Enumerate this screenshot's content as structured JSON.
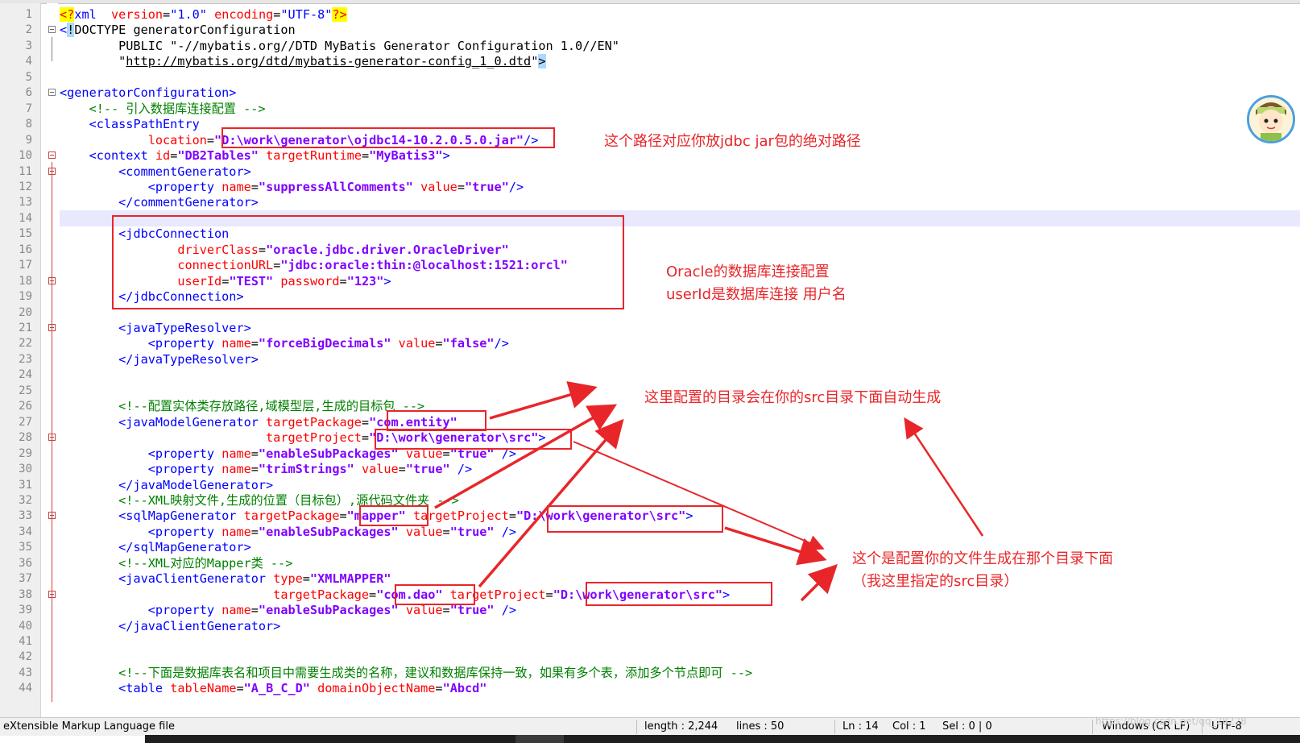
{
  "editor": {
    "lines": [
      {
        "n": "1",
        "t": [
          [
            "pi",
            "<?"
          ],
          [
            "tag",
            "xml"
          ],
          [
            "",
            "  "
          ],
          [
            "attr",
            "version"
          ],
          [
            "",
            "="
          ],
          [
            "tag",
            "\"1.0\""
          ],
          [
            "",
            " "
          ],
          [
            "attr",
            "encoding"
          ],
          [
            "",
            "="
          ],
          [
            "tag",
            "\"UTF-8\""
          ],
          [
            "pi",
            "?>"
          ]
        ]
      },
      {
        "n": "2",
        "t": [
          [
            "tag",
            "<"
          ],
          [
            "hl",
            "!"
          ],
          [
            "",
            "DOCTYPE generatorConfiguration"
          ]
        ]
      },
      {
        "n": "3",
        "t": [
          [
            "",
            "        PUBLIC \"-//mybatis.org//DTD MyBatis Generator Configuration 1.0//EN\""
          ]
        ]
      },
      {
        "n": "4",
        "t": [
          [
            "",
            "        \""
          ],
          [
            "url",
            "http://mybatis.org/dtd/mybatis-generator-config_1_0.dtd"
          ],
          [
            "",
            "\""
          ],
          [
            "hl",
            ">"
          ]
        ]
      },
      {
        "n": "5",
        "t": []
      },
      {
        "n": "6",
        "t": [
          [
            "tag",
            "<generatorConfiguration>"
          ]
        ]
      },
      {
        "n": "7",
        "t": [
          [
            "",
            "    "
          ],
          [
            "cm",
            "<!-- 引入数据库连接配置 -->"
          ]
        ]
      },
      {
        "n": "8",
        "t": [
          [
            "",
            "    "
          ],
          [
            "tag",
            "<classPathEntry"
          ]
        ]
      },
      {
        "n": "9",
        "t": [
          [
            "",
            "            "
          ],
          [
            "attr",
            "location"
          ],
          [
            "",
            "="
          ],
          [
            "val",
            "\"D:\\work\\generator\\ojdbc14-10.2.0.5.0.jar\""
          ],
          [
            "tag",
            "/>"
          ]
        ]
      },
      {
        "n": "10",
        "t": [
          [
            "",
            "    "
          ],
          [
            "tag",
            "<context"
          ],
          [
            "",
            " "
          ],
          [
            "attr",
            "id"
          ],
          [
            "",
            "="
          ],
          [
            "val",
            "\"DB2Tables\""
          ],
          [
            "",
            " "
          ],
          [
            "attr",
            "targetRuntime"
          ],
          [
            "",
            "="
          ],
          [
            "val",
            "\"MyBatis3\""
          ],
          [
            "tag",
            ">"
          ]
        ]
      },
      {
        "n": "11",
        "t": [
          [
            "",
            "        "
          ],
          [
            "tag",
            "<commentGenerator>"
          ]
        ]
      },
      {
        "n": "12",
        "t": [
          [
            "",
            "            "
          ],
          [
            "tag",
            "<property"
          ],
          [
            "",
            " "
          ],
          [
            "attr",
            "name"
          ],
          [
            "",
            "="
          ],
          [
            "val",
            "\"suppressAllComments\""
          ],
          [
            "",
            " "
          ],
          [
            "attr",
            "value"
          ],
          [
            "",
            "="
          ],
          [
            "val",
            "\"true\""
          ],
          [
            "tag",
            "/>"
          ]
        ]
      },
      {
        "n": "13",
        "t": [
          [
            "",
            "        "
          ],
          [
            "tag",
            "</commentGenerator>"
          ]
        ]
      },
      {
        "n": "14",
        "t": []
      },
      {
        "n": "15",
        "t": [
          [
            "",
            "        "
          ],
          [
            "tag",
            "<jdbcConnection"
          ]
        ]
      },
      {
        "n": "16",
        "t": [
          [
            "",
            "                "
          ],
          [
            "attr",
            "driverClass"
          ],
          [
            "",
            "="
          ],
          [
            "val",
            "\"oracle.jdbc.driver.OracleDriver\""
          ]
        ]
      },
      {
        "n": "17",
        "t": [
          [
            "",
            "                "
          ],
          [
            "attr",
            "connectionURL"
          ],
          [
            "",
            "="
          ],
          [
            "val",
            "\"jdbc:oracle:thin:@localhost:1521:orcl\""
          ]
        ]
      },
      {
        "n": "18",
        "t": [
          [
            "",
            "                "
          ],
          [
            "attr",
            "userId"
          ],
          [
            "",
            "="
          ],
          [
            "val",
            "\"TEST\""
          ],
          [
            "",
            " "
          ],
          [
            "attr",
            "password"
          ],
          [
            "",
            "="
          ],
          [
            "val",
            "\"123\""
          ],
          [
            "tag",
            ">"
          ]
        ]
      },
      {
        "n": "19",
        "t": [
          [
            "",
            "        "
          ],
          [
            "tag",
            "</jdbcConnection>"
          ]
        ]
      },
      {
        "n": "20",
        "t": []
      },
      {
        "n": "21",
        "t": [
          [
            "",
            "        "
          ],
          [
            "tag",
            "<javaTypeResolver>"
          ]
        ]
      },
      {
        "n": "22",
        "t": [
          [
            "",
            "            "
          ],
          [
            "tag",
            "<property"
          ],
          [
            "",
            " "
          ],
          [
            "attr",
            "name"
          ],
          [
            "",
            "="
          ],
          [
            "val",
            "\"forceBigDecimals\""
          ],
          [
            "",
            " "
          ],
          [
            "attr",
            "value"
          ],
          [
            "",
            "="
          ],
          [
            "val",
            "\"false\""
          ],
          [
            "tag",
            "/>"
          ]
        ]
      },
      {
        "n": "23",
        "t": [
          [
            "",
            "        "
          ],
          [
            "tag",
            "</javaTypeResolver>"
          ]
        ]
      },
      {
        "n": "24",
        "t": []
      },
      {
        "n": "25",
        "t": []
      },
      {
        "n": "26",
        "t": [
          [
            "",
            "        "
          ],
          [
            "cm",
            "<!--配置实体类存放路径,域模型层,生成的目标包 -->"
          ]
        ]
      },
      {
        "n": "27",
        "t": [
          [
            "",
            "        "
          ],
          [
            "tag",
            "<javaModelGenerator"
          ],
          [
            "",
            " "
          ],
          [
            "attr",
            "targetPackage"
          ],
          [
            "",
            "="
          ],
          [
            "val",
            "\"com.entity\""
          ]
        ]
      },
      {
        "n": "28",
        "t": [
          [
            "",
            "                            "
          ],
          [
            "attr",
            "targetProject"
          ],
          [
            "",
            "="
          ],
          [
            "val",
            "\"D:\\work\\generator\\src\""
          ],
          [
            "tag",
            ">"
          ]
        ]
      },
      {
        "n": "29",
        "t": [
          [
            "",
            "            "
          ],
          [
            "tag",
            "<property"
          ],
          [
            "",
            " "
          ],
          [
            "attr",
            "name"
          ],
          [
            "",
            "="
          ],
          [
            "val",
            "\"enableSubPackages\""
          ],
          [
            "",
            " "
          ],
          [
            "attr",
            "value"
          ],
          [
            "",
            "="
          ],
          [
            "val",
            "\"true\""
          ],
          [
            "",
            " "
          ],
          [
            "tag",
            "/>"
          ]
        ]
      },
      {
        "n": "30",
        "t": [
          [
            "",
            "            "
          ],
          [
            "tag",
            "<property"
          ],
          [
            "",
            " "
          ],
          [
            "attr",
            "name"
          ],
          [
            "",
            "="
          ],
          [
            "val",
            "\"trimStrings\""
          ],
          [
            "",
            " "
          ],
          [
            "attr",
            "value"
          ],
          [
            "",
            "="
          ],
          [
            "val",
            "\"true\""
          ],
          [
            "",
            " "
          ],
          [
            "tag",
            "/>"
          ]
        ]
      },
      {
        "n": "31",
        "t": [
          [
            "",
            "        "
          ],
          [
            "tag",
            "</javaModelGenerator>"
          ]
        ]
      },
      {
        "n": "32",
        "t": [
          [
            "",
            "        "
          ],
          [
            "cm",
            "<!--XML映射文件,生成的位置（目标包）,源代码文件夹 -->"
          ]
        ]
      },
      {
        "n": "33",
        "t": [
          [
            "",
            "        "
          ],
          [
            "tag",
            "<sqlMapGenerator"
          ],
          [
            "",
            " "
          ],
          [
            "attr",
            "targetPackage"
          ],
          [
            "",
            "="
          ],
          [
            "val",
            "\"mapper\""
          ],
          [
            "",
            " "
          ],
          [
            "attr",
            "targetProject"
          ],
          [
            "",
            "="
          ],
          [
            "val",
            "\"D:\\work\\generator\\src\""
          ],
          [
            "tag",
            ">"
          ]
        ]
      },
      {
        "n": "34",
        "t": [
          [
            "",
            "            "
          ],
          [
            "tag",
            "<property"
          ],
          [
            "",
            " "
          ],
          [
            "attr",
            "name"
          ],
          [
            "",
            "="
          ],
          [
            "val",
            "\"enableSubPackages\""
          ],
          [
            "",
            " "
          ],
          [
            "attr",
            "value"
          ],
          [
            "",
            "="
          ],
          [
            "val",
            "\"true\""
          ],
          [
            "",
            " "
          ],
          [
            "tag",
            "/>"
          ]
        ]
      },
      {
        "n": "35",
        "t": [
          [
            "",
            "        "
          ],
          [
            "tag",
            "</sqlMapGenerator>"
          ]
        ]
      },
      {
        "n": "36",
        "t": [
          [
            "",
            "        "
          ],
          [
            "cm",
            "<!--XML对应的Mapper类 -->"
          ]
        ]
      },
      {
        "n": "37",
        "t": [
          [
            "",
            "        "
          ],
          [
            "tag",
            "<javaClientGenerator"
          ],
          [
            "",
            " "
          ],
          [
            "attr",
            "type"
          ],
          [
            "",
            "="
          ],
          [
            "val",
            "\"XMLMAPPER\""
          ]
        ]
      },
      {
        "n": "38",
        "t": [
          [
            "",
            "                             "
          ],
          [
            "attr",
            "targetPackage"
          ],
          [
            "",
            "="
          ],
          [
            "val",
            "\"com.dao\""
          ],
          [
            "",
            " "
          ],
          [
            "attr",
            "targetProject"
          ],
          [
            "",
            "="
          ],
          [
            "val",
            "\"D:\\work\\generator\\src\""
          ],
          [
            "tag",
            ">"
          ]
        ]
      },
      {
        "n": "39",
        "t": [
          [
            "",
            "            "
          ],
          [
            "tag",
            "<property"
          ],
          [
            "",
            " "
          ],
          [
            "attr",
            "name"
          ],
          [
            "",
            "="
          ],
          [
            "val",
            "\"enableSubPackages\""
          ],
          [
            "",
            " "
          ],
          [
            "attr",
            "value"
          ],
          [
            "",
            "="
          ],
          [
            "val",
            "\"true\""
          ],
          [
            "",
            " "
          ],
          [
            "tag",
            "/>"
          ]
        ]
      },
      {
        "n": "40",
        "t": [
          [
            "",
            "        "
          ],
          [
            "tag",
            "</javaClientGenerator>"
          ]
        ]
      },
      {
        "n": "41",
        "t": []
      },
      {
        "n": "42",
        "t": []
      },
      {
        "n": "43",
        "t": [
          [
            "",
            "        "
          ],
          [
            "cm",
            "<!--下面是数据库表名和项目中需要生成类的名称，建议和数据库保持一致，如果有多个表，添加多个节点即可 -->"
          ]
        ]
      },
      {
        "n": "44",
        "t": [
          [
            "",
            "        "
          ],
          [
            "tag",
            "<table"
          ],
          [
            "",
            " "
          ],
          [
            "attr",
            "tableName"
          ],
          [
            "",
            "="
          ],
          [
            "val",
            "\"A_B_C_D\""
          ],
          [
            "",
            " "
          ],
          [
            "attr",
            "domainObjectName"
          ],
          [
            "",
            "="
          ],
          [
            "val",
            "\"Abcd\""
          ]
        ]
      }
    ],
    "current_line": "14",
    "annotation_color": "#e8262a"
  },
  "annotations": {
    "jar_path_note": "这个路径对应你放jdbc jar包的绝对路径",
    "jdbc_note_line1": "Oracle的数据库连接配置",
    "jdbc_note_line2": "userId是数据库连接 用户名",
    "src_auto_note": "这里配置的目录会在你的src目录下面自动生成",
    "target_dir_note_line1": "这个是配置你的文件生成在那个目录下面",
    "target_dir_note_line2": "（我这里指定的src目录）"
  },
  "statusbar": {
    "file_type": "eXtensible Markup Language file",
    "length": "length : 2,244",
    "lines": "lines : 50",
    "ln": "Ln : 14",
    "col": "Col : 1",
    "sel": "Sel : 0 | 0",
    "eol": "Windows (CR LF)",
    "encoding": "UTF-8"
  },
  "watermark": "https://blog.csdn.net/qq_28228",
  "icons": [
    "fold-marker-icon",
    "avatar-icon"
  ]
}
